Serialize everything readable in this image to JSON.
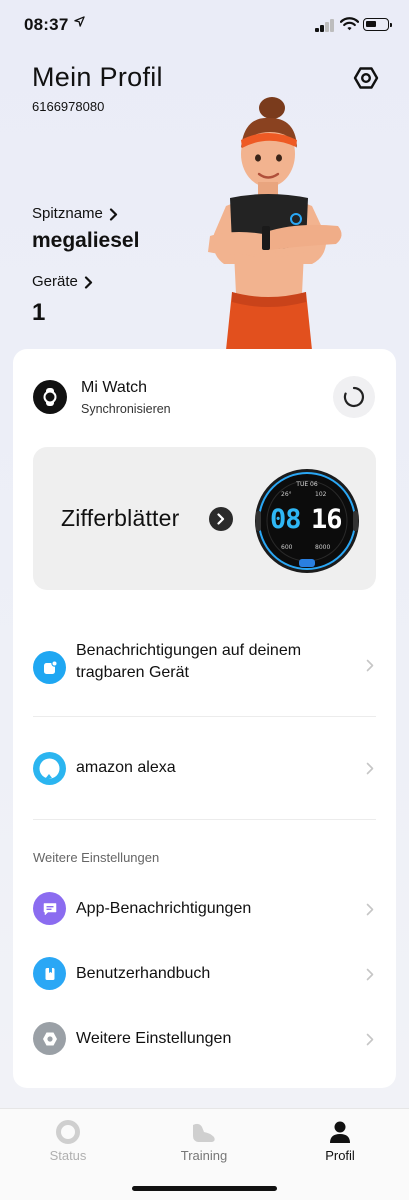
{
  "status_bar": {
    "time": "08:37"
  },
  "header": {
    "title": "Mein Profil",
    "user_id": "6166978080",
    "nickname_label": "Spitzname",
    "nickname_value": "megaliesel",
    "devices_label": "Geräte",
    "devices_value": "1"
  },
  "device": {
    "name": "Mi Watch",
    "status": "Synchronisieren"
  },
  "watchface_card": {
    "title": "Zifferblätter",
    "preview": {
      "date": "TUE 06",
      "heart_rate": "26°",
      "steps_small": "102",
      "time_hours": "08",
      "time_minutes": "16",
      "calories": "600",
      "steps": "8000"
    }
  },
  "rows": {
    "notifications_wearable": "Benachrichtigungen auf deinem tragbaren Gerät",
    "alexa": "amazon alexa",
    "section_header": "Weitere Einstellungen",
    "app_notifications": "App-Benachrichtigungen",
    "user_manual": "Benutzerhandbuch",
    "more_settings": "Weitere Einstellungen"
  },
  "tabs": [
    {
      "label": "Status",
      "active": false
    },
    {
      "label": "Training",
      "active": false
    },
    {
      "label": "Profil",
      "active": true
    }
  ],
  "colors": {
    "accent_blue": "#2aa7f5",
    "purple": "#8b6cf0",
    "gray_icon": "#9aa0a6",
    "alexa_blue": "#2bb5f0",
    "tab_active": "#111111",
    "tab_inactive": "#9a9a9a"
  }
}
